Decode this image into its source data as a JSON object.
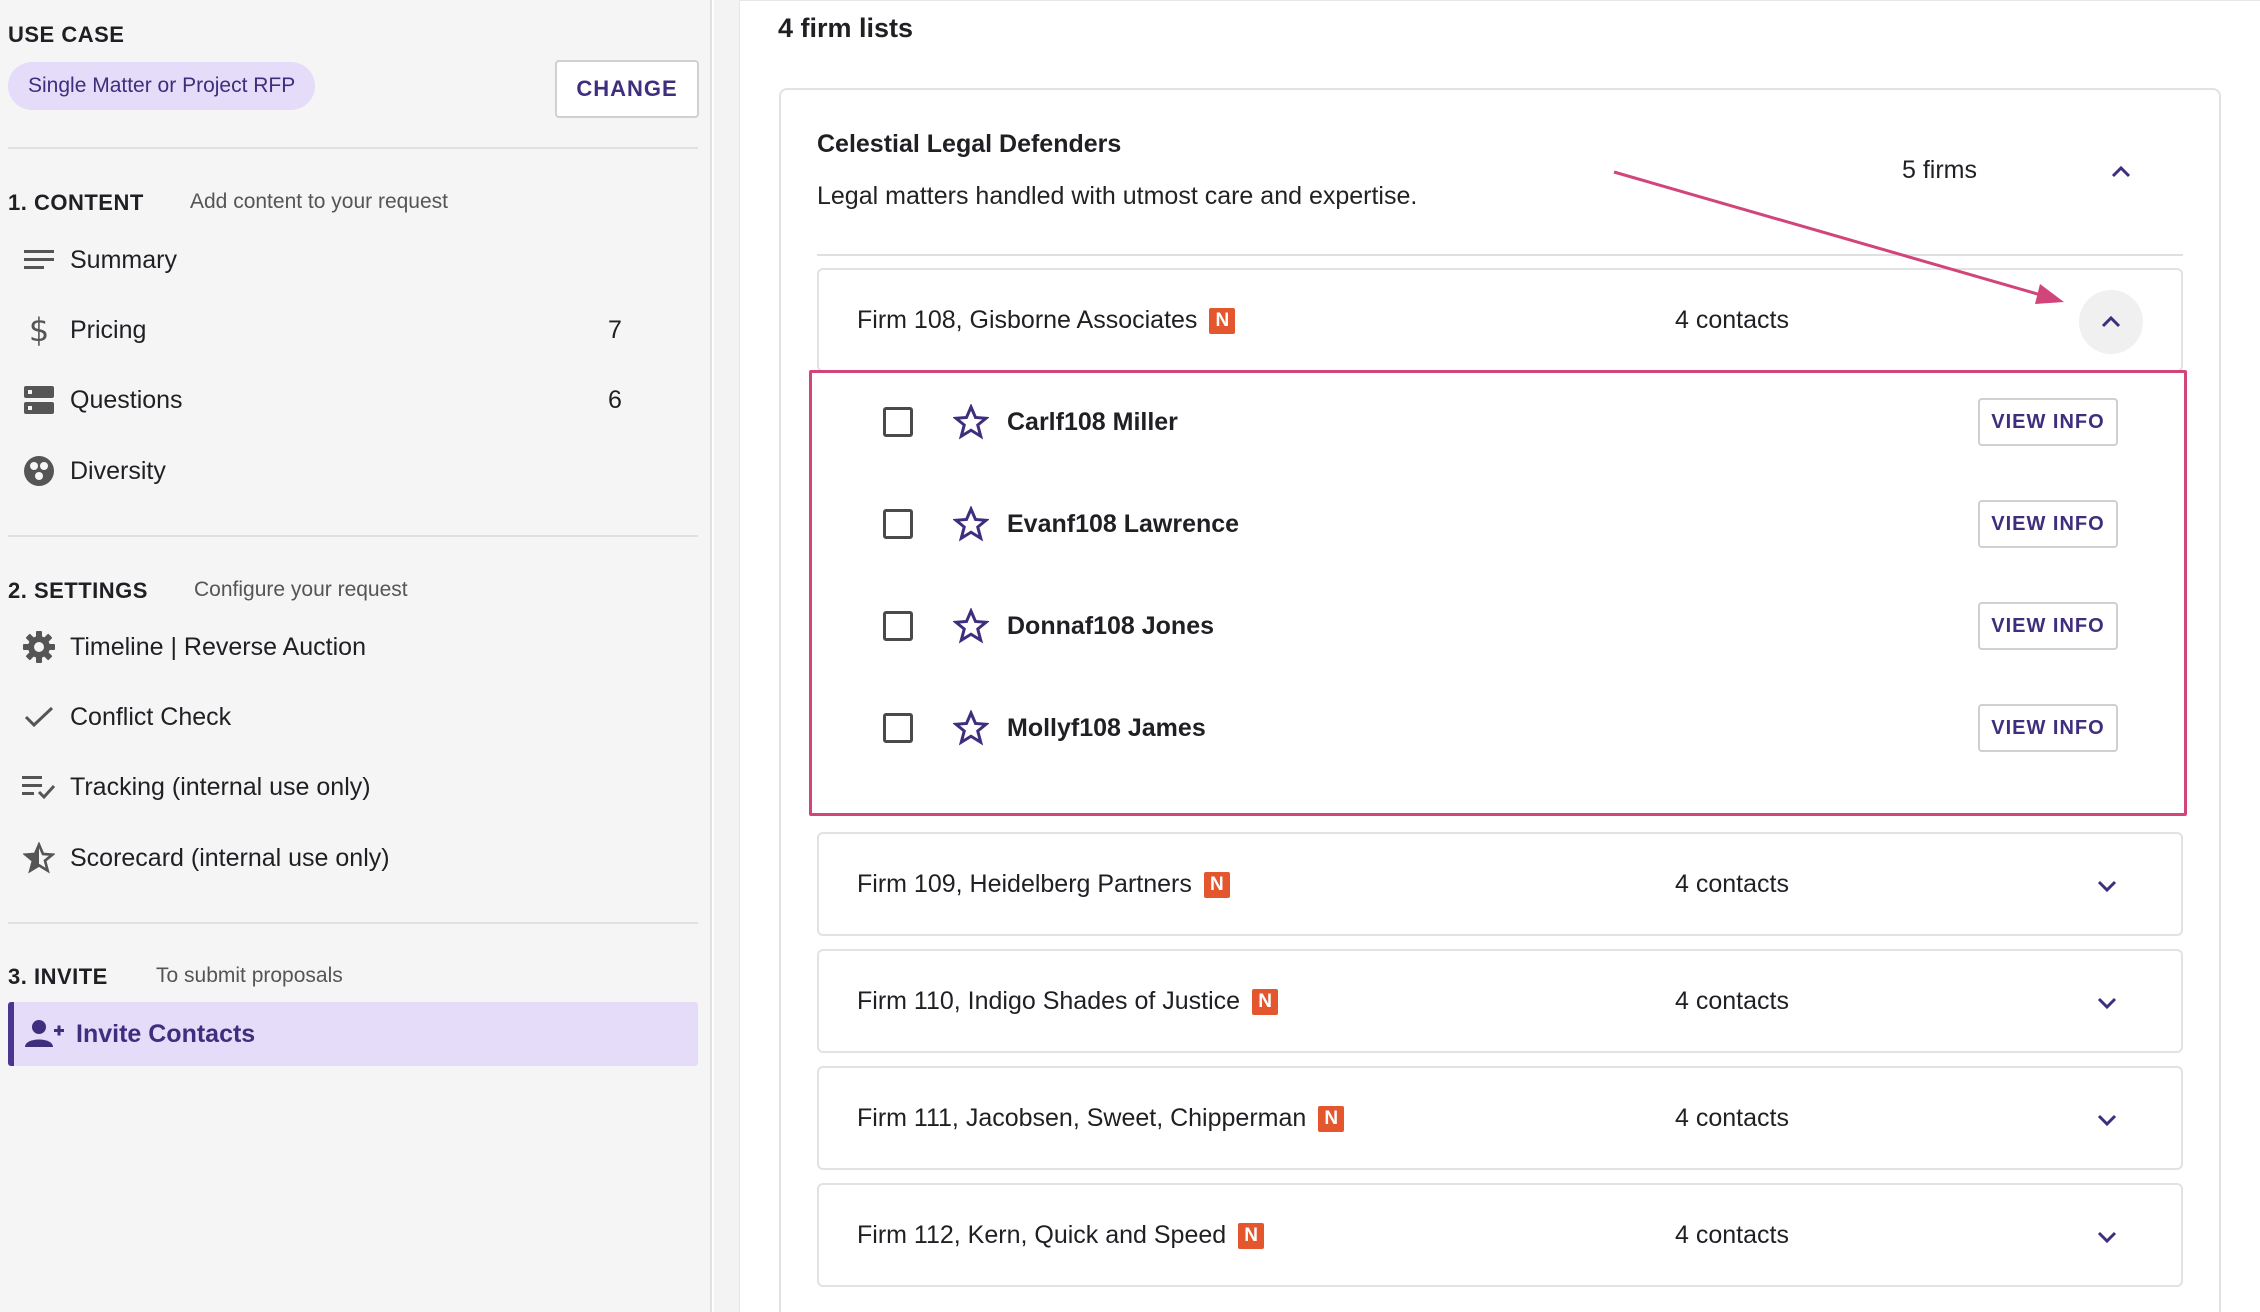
{
  "sidebar": {
    "use_case": {
      "title": "USE CASE",
      "chip": "Single Matter or Project RFP",
      "change_label": "CHANGE"
    },
    "content": {
      "heading": "1. CONTENT",
      "subtitle": "Add content to your request",
      "items": [
        {
          "label": "Summary",
          "icon": "lines-icon",
          "count": ""
        },
        {
          "label": "Pricing",
          "icon": "dollar-icon",
          "count": "7"
        },
        {
          "label": "Questions",
          "icon": "storage-icon",
          "count": "6"
        },
        {
          "label": "Diversity",
          "icon": "diversity-icon",
          "count": ""
        }
      ]
    },
    "settings": {
      "heading": "2. SETTINGS",
      "subtitle": "Configure your request",
      "items": [
        {
          "label": "Timeline | Reverse Auction",
          "icon": "gear-icon"
        },
        {
          "label": "Conflict Check",
          "icon": "check-icon"
        },
        {
          "label": "Tracking (internal use only)",
          "icon": "checklist-icon"
        },
        {
          "label": "Scorecard (internal use only)",
          "icon": "star-half-icon"
        }
      ]
    },
    "invite": {
      "heading": "3. INVITE",
      "subtitle": "To submit proposals",
      "items": [
        {
          "label": "Invite Contacts",
          "icon": "person-add-icon",
          "active": true
        }
      ]
    }
  },
  "main": {
    "title": "4 firm lists",
    "list": {
      "name": "Celestial Legal Defenders",
      "description": "Legal matters handled with utmost care and expertise.",
      "count": "5 firms"
    },
    "firms": [
      {
        "name": "Firm 108, Gisborne Associates",
        "badge": "N",
        "contacts_label": "4 contacts",
        "expanded": true,
        "contacts": [
          {
            "name": "Carlf108 Miller",
            "action": "VIEW INFO"
          },
          {
            "name": "Evanf108 Lawrence",
            "action": "VIEW INFO"
          },
          {
            "name": "Donnaf108 Jones",
            "action": "VIEW INFO"
          },
          {
            "name": "Mollyf108 James",
            "action": "VIEW INFO"
          }
        ]
      },
      {
        "name": "Firm 109, Heidelberg Partners",
        "badge": "N",
        "contacts_label": "4 contacts",
        "expanded": false
      },
      {
        "name": "Firm 110, Indigo Shades of Justice",
        "badge": "N",
        "contacts_label": "4 contacts",
        "expanded": false
      },
      {
        "name": "Firm 111, Jacobsen, Sweet, Chipperman",
        "badge": "N",
        "contacts_label": "4 contacts",
        "expanded": false
      },
      {
        "name": "Firm 112, Kern, Quick and Speed",
        "badge": "N",
        "contacts_label": "4 contacts",
        "expanded": false
      }
    ]
  },
  "colors": {
    "accent": "#3f2d7d",
    "chip_bg": "#e4dcf8",
    "badge": "#e4572e",
    "annotation": "#d1457a"
  }
}
